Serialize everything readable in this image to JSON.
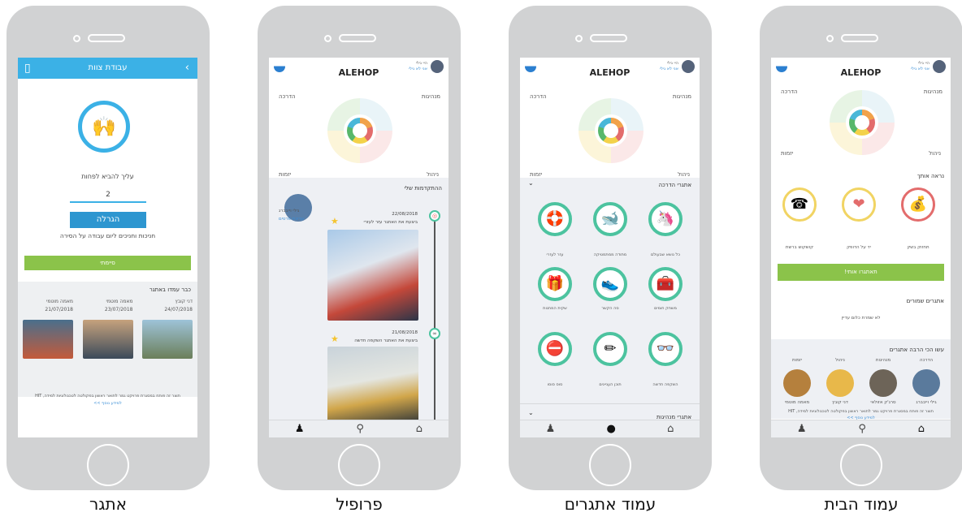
{
  "captions": {
    "challenge": "אתגר",
    "profile": "פרופיל",
    "challenges_page": "עמוד אתגרים",
    "home": "עמוד הבית"
  },
  "app": {
    "logo": "ALEHOP",
    "user_name": "היי גילי",
    "user_link": "אני לא גילי",
    "accent": "#3bb1e6",
    "green": "#8bc34a",
    "teal": "#4cc39f"
  },
  "radar_labels": {
    "guidance": "הדרכה",
    "leadership": "מנהיגות",
    "initiative": "יזמות",
    "management": "ניהול"
  },
  "challenge_screen": {
    "title": "עבודת צוות",
    "need_text": "עליך להביא לפחות",
    "count": "2",
    "raffle_button": "הגרלה",
    "subtitle": "חניכות וחניכים ליום עבודה על הסירה",
    "done_button": "סיימתי",
    "already_done": "כבר עמדו באתגר",
    "winners": [
      {
        "name": "דני קובץ",
        "date": "24/07/2018"
      },
      {
        "name": "מאמה מוטמי",
        "date": "23/07/2018"
      },
      {
        "name": "מאמה מוטמי",
        "date": "21/07/2018"
      }
    ],
    "footer": "תוצר זה פותח במסגרת פרויקט גמר לתואר ראשון בפקולטה לטכנולוגיות למידה, HIT",
    "footer_link": "למידע נוסף >>"
  },
  "profile_screen": {
    "progress_title": "ההתקדמות שלי",
    "profile_name": "גילי וייבברג",
    "edit_details": "עריכת פרטים",
    "entries": [
      {
        "date": "22/08/2018",
        "text": "ביצעת את האתגר עזר לעזרי"
      },
      {
        "date": "21/08/2018",
        "text": "ביצעת את האתגר השקפה חדשה"
      }
    ]
  },
  "challenges_screen": {
    "section_guidance": "אתגרי הדרכה",
    "section_leadership": "אתגרי מנהיגות",
    "badges": [
      {
        "label": "כל נושא שבעולם",
        "icon": "🦄"
      },
      {
        "label": "מתודה ממתמטיקה",
        "icon": "🐋"
      },
      {
        "label": "עזר לעזרי",
        "icon": "🛟"
      },
      {
        "label": "משחק חומים",
        "icon": "🧰"
      },
      {
        "label": "סה הקשר",
        "icon": "👟"
      },
      {
        "label": "שקית המתנות",
        "icon": "🎁"
      },
      {
        "label": "השקפה חדשה",
        "icon": "👓"
      },
      {
        "label": "תוכן העניינים",
        "icon": "✏"
      },
      {
        "label": "סוס סוסו",
        "icon": "⛔"
      }
    ]
  },
  "home_screen": {
    "see_you": "נראה אותך",
    "tasks": [
      {
        "label": "תחזוק בשק",
        "icon": "💰",
        "border": "#e36c6c"
      },
      {
        "label": "יד על הדופק",
        "icon": "❤",
        "border": "#f1d463"
      },
      {
        "label": "קושקוש ברשת",
        "icon": "☎",
        "border": "#f1d463"
      }
    ],
    "challenge_me": "תאתגרו אותי!",
    "saved_title": "אתגרים שמורים",
    "no_saved": "לא שמרת כלום עדיין",
    "most_title": "עשו הכי הרבה אתגרים",
    "categories": [
      {
        "cat": "הדרכה",
        "name": "גילי וייבברג"
      },
      {
        "cat": "מנהיגות",
        "name": "סרג'ק אזולאי"
      },
      {
        "cat": "ניהול",
        "name": "דני קובץ"
      },
      {
        "cat": "יזמות",
        "name": "מאמה מוטמי"
      }
    ],
    "footer": "תוצר זה פותח במסגרת פרויקט גמר לתואר ראשון בפקולטה לטכנולוגיות למידה, HIT",
    "footer_link": "למידע נוסף >>"
  }
}
